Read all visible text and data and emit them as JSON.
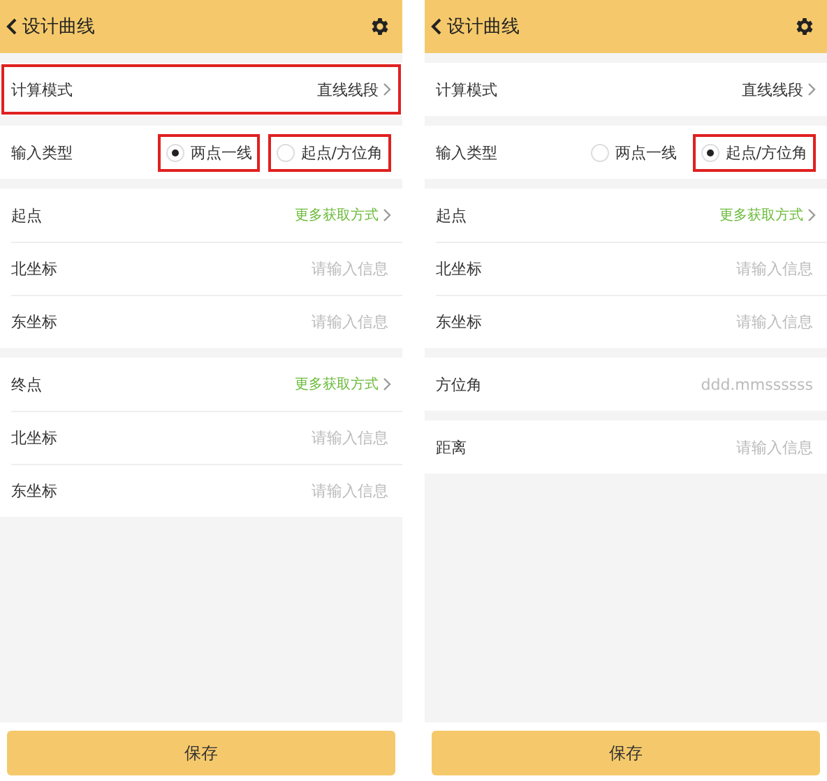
{
  "screens": [
    {
      "title": "设计曲线",
      "sections": [
        {
          "rows": [
            {
              "kind": "select",
              "label": "计算模式",
              "value": "直线线段",
              "highlighted": true
            }
          ]
        },
        {
          "rows": [
            {
              "kind": "radio",
              "label": "输入类型",
              "options": [
                {
                  "label": "两点一线",
                  "selected": true,
                  "highlighted": true
                },
                {
                  "label": "起点/方位角",
                  "selected": false,
                  "highlighted": true
                }
              ]
            }
          ]
        },
        {
          "rows": [
            {
              "kind": "link",
              "label": "起点",
              "link": "更多获取方式"
            },
            {
              "kind": "input",
              "label": "北坐标",
              "placeholder": "请输入信息"
            },
            {
              "kind": "input",
              "label": "东坐标",
              "placeholder": "请输入信息"
            }
          ]
        },
        {
          "rows": [
            {
              "kind": "link",
              "label": "终点",
              "link": "更多获取方式"
            },
            {
              "kind": "input",
              "label": "北坐标",
              "placeholder": "请输入信息"
            },
            {
              "kind": "input",
              "label": "东坐标",
              "placeholder": "请输入信息"
            }
          ]
        }
      ],
      "save_button": "保存"
    },
    {
      "title": "设计曲线",
      "sections": [
        {
          "rows": [
            {
              "kind": "select",
              "label": "计算模式",
              "value": "直线线段",
              "highlighted": false
            }
          ]
        },
        {
          "rows": [
            {
              "kind": "radio",
              "label": "输入类型",
              "options": [
                {
                  "label": "两点一线",
                  "selected": false,
                  "highlighted": false
                },
                {
                  "label": "起点/方位角",
                  "selected": true,
                  "highlighted": true
                }
              ]
            }
          ]
        },
        {
          "rows": [
            {
              "kind": "link",
              "label": "起点",
              "link": "更多获取方式"
            },
            {
              "kind": "input",
              "label": "北坐标",
              "placeholder": "请输入信息"
            },
            {
              "kind": "input",
              "label": "东坐标",
              "placeholder": "请输入信息"
            }
          ]
        },
        {
          "rows": [
            {
              "kind": "input",
              "label": "方位角",
              "placeholder": "ddd.mmssssss"
            }
          ]
        },
        {
          "rows": [
            {
              "kind": "input",
              "label": "距离",
              "placeholder": "请输入信息"
            }
          ]
        }
      ],
      "save_button": "保存"
    }
  ]
}
